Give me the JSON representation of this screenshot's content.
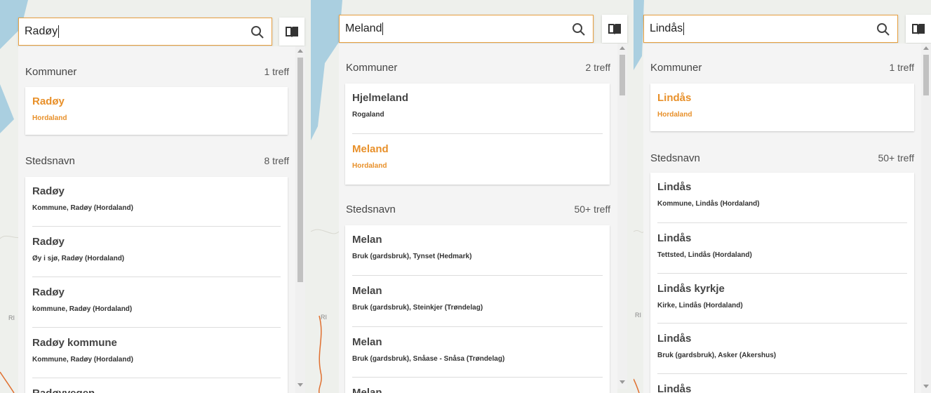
{
  "panels": [
    {
      "search_value": "Radøy",
      "sections": [
        {
          "title": "Kommuner",
          "count": "1 treff",
          "items": [
            {
              "name": "Radøy",
              "sub": "Hordaland",
              "selected": true
            }
          ]
        },
        {
          "title": "Stedsnavn",
          "count": "8 treff",
          "items": [
            {
              "name": "Radøy",
              "sub": "Kommune, Radøy (Hordaland)"
            },
            {
              "name": "Radøy",
              "sub": "Øy i sjø, Radøy (Hordaland)"
            },
            {
              "name": "Radøy",
              "sub": "kommune, Radøy (Hordaland)"
            },
            {
              "name": "Radøy kommune",
              "sub": "Kommune, Radøy (Hordaland)"
            },
            {
              "name": "Radøyvegen",
              "sub": ""
            }
          ]
        }
      ]
    },
    {
      "search_value": "Meland",
      "sections": [
        {
          "title": "Kommuner",
          "count": "2 treff",
          "items": [
            {
              "name": "Hjelmeland",
              "sub": "Rogaland"
            },
            {
              "name": "Meland",
              "sub": "Hordaland",
              "selected": true
            }
          ]
        },
        {
          "title": "Stedsnavn",
          "count": "50+ treff",
          "items": [
            {
              "name": "Melan",
              "sub": "Bruk (gardsbruk), Tynset (Hedmark)"
            },
            {
              "name": "Melan",
              "sub": "Bruk (gardsbruk), Steinkjer (Trøndelag)"
            },
            {
              "name": "Melan",
              "sub": "Bruk (gardsbruk), Snåase - Snåsa (Trøndelag)"
            },
            {
              "name": "Melan",
              "sub": ""
            }
          ]
        }
      ]
    },
    {
      "search_value": "Lindås",
      "sections": [
        {
          "title": "Kommuner",
          "count": "1 treff",
          "items": [
            {
              "name": "Lindås",
              "sub": "Hordaland",
              "selected": true
            }
          ]
        },
        {
          "title": "Stedsnavn",
          "count": "50+ treff",
          "items": [
            {
              "name": "Lindås",
              "sub": "Kommune, Lindås (Hordaland)"
            },
            {
              "name": "Lindås",
              "sub": "Tettsted, Lindås (Hordaland)"
            },
            {
              "name": "Lindås kyrkje",
              "sub": "Kirke, Lindås (Hordaland)"
            },
            {
              "name": "Lindås",
              "sub": "Bruk (gardsbruk), Asker (Akershus)"
            },
            {
              "name": "Lindås",
              "sub": ""
            }
          ]
        }
      ]
    }
  ],
  "icons": {
    "search": "search-icon",
    "book": "book-icon"
  },
  "colors": {
    "accent": "#e8902a",
    "search_border": "#e8a040"
  },
  "map_labels": {
    "left": "RI",
    "middle": "RI",
    "right": "RI"
  }
}
